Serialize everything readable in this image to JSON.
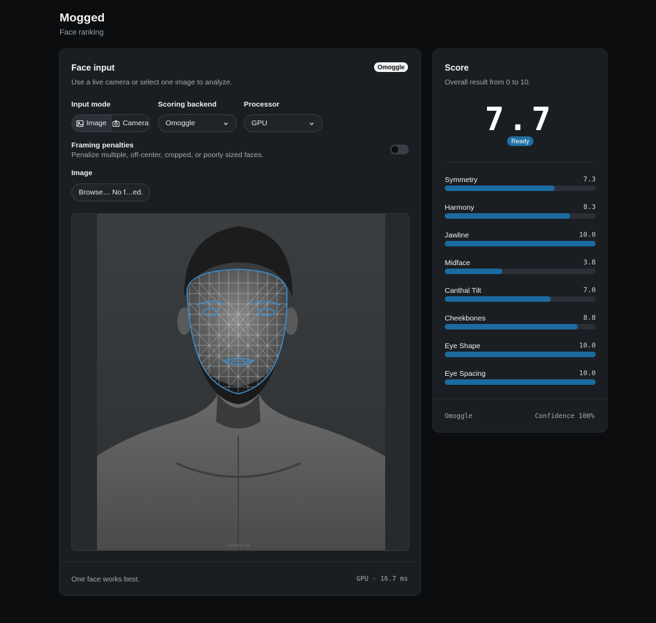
{
  "app": {
    "title": "Mogged",
    "subtitle": "Face ranking"
  },
  "input_card": {
    "title": "Face input",
    "badge": "Omoggle",
    "description": "Use a live camera or select one image to analyze.",
    "input_mode": {
      "label": "Input mode",
      "options": [
        {
          "label": "Image",
          "icon": "image-icon",
          "active": true
        },
        {
          "label": "Camera",
          "icon": "camera-icon",
          "active": false
        }
      ]
    },
    "scoring_backend": {
      "label": "Scoring backend",
      "value": "Omoggle"
    },
    "processor": {
      "label": "Processor",
      "value": "GPU"
    },
    "framing": {
      "label": "Framing penalties",
      "description": "Penalize multiple, off-center, cropped, or poorly sized faces.",
      "enabled": false
    },
    "image": {
      "label": "Image",
      "file_button": "Browse… No f…ed.",
      "watermark": "MERWYLDR"
    },
    "footer": {
      "hint": "One face works best.",
      "timing": "GPU · 16.7 ms"
    }
  },
  "score_card": {
    "title": "Score",
    "description": "Overall result from 0 to 10.",
    "overall": "7.7",
    "status": "Ready",
    "metrics": [
      {
        "name": "Symmetry",
        "value": "7.3",
        "fraction": 0.73
      },
      {
        "name": "Harmony",
        "value": "8.3",
        "fraction": 0.83
      },
      {
        "name": "Jawline",
        "value": "10.0",
        "fraction": 1.0
      },
      {
        "name": "Midface",
        "value": "3.8",
        "fraction": 0.38
      },
      {
        "name": "Canthal Tilt",
        "value": "7.0",
        "fraction": 0.7
      },
      {
        "name": "Cheekbones",
        "value": "8.8",
        "fraction": 0.88
      },
      {
        "name": "Eye Shape",
        "value": "10.0",
        "fraction": 1.0
      },
      {
        "name": "Eye Spacing",
        "value": "10.0",
        "fraction": 1.0
      }
    ],
    "footer": {
      "backend": "Omoggle",
      "confidence": "Confidence 100%"
    }
  },
  "colors": {
    "accent": "#1b6aa0",
    "background": "#0b0d0f",
    "card": "#1a1e22",
    "mesh": "#3a8fd0"
  }
}
